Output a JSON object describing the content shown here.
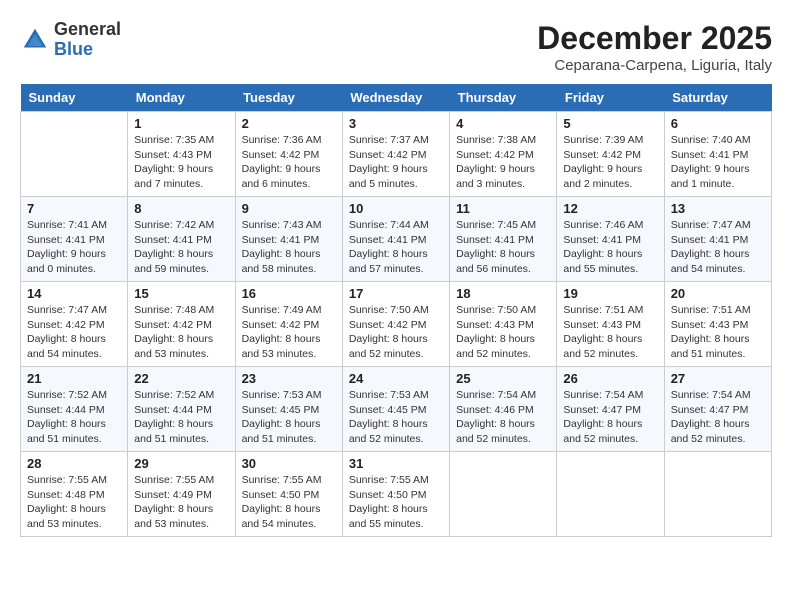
{
  "header": {
    "logo_general": "General",
    "logo_blue": "Blue",
    "month_title": "December 2025",
    "location": "Ceparana-Carpena, Liguria, Italy"
  },
  "weekdays": [
    "Sunday",
    "Monday",
    "Tuesday",
    "Wednesday",
    "Thursday",
    "Friday",
    "Saturday"
  ],
  "weeks": [
    [
      {
        "day": "",
        "info": ""
      },
      {
        "day": "1",
        "info": "Sunrise: 7:35 AM\nSunset: 4:43 PM\nDaylight: 9 hours\nand 7 minutes."
      },
      {
        "day": "2",
        "info": "Sunrise: 7:36 AM\nSunset: 4:42 PM\nDaylight: 9 hours\nand 6 minutes."
      },
      {
        "day": "3",
        "info": "Sunrise: 7:37 AM\nSunset: 4:42 PM\nDaylight: 9 hours\nand 5 minutes."
      },
      {
        "day": "4",
        "info": "Sunrise: 7:38 AM\nSunset: 4:42 PM\nDaylight: 9 hours\nand 3 minutes."
      },
      {
        "day": "5",
        "info": "Sunrise: 7:39 AM\nSunset: 4:42 PM\nDaylight: 9 hours\nand 2 minutes."
      },
      {
        "day": "6",
        "info": "Sunrise: 7:40 AM\nSunset: 4:41 PM\nDaylight: 9 hours\nand 1 minute."
      }
    ],
    [
      {
        "day": "7",
        "info": "Sunrise: 7:41 AM\nSunset: 4:41 PM\nDaylight: 9 hours\nand 0 minutes."
      },
      {
        "day": "8",
        "info": "Sunrise: 7:42 AM\nSunset: 4:41 PM\nDaylight: 8 hours\nand 59 minutes."
      },
      {
        "day": "9",
        "info": "Sunrise: 7:43 AM\nSunset: 4:41 PM\nDaylight: 8 hours\nand 58 minutes."
      },
      {
        "day": "10",
        "info": "Sunrise: 7:44 AM\nSunset: 4:41 PM\nDaylight: 8 hours\nand 57 minutes."
      },
      {
        "day": "11",
        "info": "Sunrise: 7:45 AM\nSunset: 4:41 PM\nDaylight: 8 hours\nand 56 minutes."
      },
      {
        "day": "12",
        "info": "Sunrise: 7:46 AM\nSunset: 4:41 PM\nDaylight: 8 hours\nand 55 minutes."
      },
      {
        "day": "13",
        "info": "Sunrise: 7:47 AM\nSunset: 4:41 PM\nDaylight: 8 hours\nand 54 minutes."
      }
    ],
    [
      {
        "day": "14",
        "info": "Sunrise: 7:47 AM\nSunset: 4:42 PM\nDaylight: 8 hours\nand 54 minutes."
      },
      {
        "day": "15",
        "info": "Sunrise: 7:48 AM\nSunset: 4:42 PM\nDaylight: 8 hours\nand 53 minutes."
      },
      {
        "day": "16",
        "info": "Sunrise: 7:49 AM\nSunset: 4:42 PM\nDaylight: 8 hours\nand 53 minutes."
      },
      {
        "day": "17",
        "info": "Sunrise: 7:50 AM\nSunset: 4:42 PM\nDaylight: 8 hours\nand 52 minutes."
      },
      {
        "day": "18",
        "info": "Sunrise: 7:50 AM\nSunset: 4:43 PM\nDaylight: 8 hours\nand 52 minutes."
      },
      {
        "day": "19",
        "info": "Sunrise: 7:51 AM\nSunset: 4:43 PM\nDaylight: 8 hours\nand 52 minutes."
      },
      {
        "day": "20",
        "info": "Sunrise: 7:51 AM\nSunset: 4:43 PM\nDaylight: 8 hours\nand 51 minutes."
      }
    ],
    [
      {
        "day": "21",
        "info": "Sunrise: 7:52 AM\nSunset: 4:44 PM\nDaylight: 8 hours\nand 51 minutes."
      },
      {
        "day": "22",
        "info": "Sunrise: 7:52 AM\nSunset: 4:44 PM\nDaylight: 8 hours\nand 51 minutes."
      },
      {
        "day": "23",
        "info": "Sunrise: 7:53 AM\nSunset: 4:45 PM\nDaylight: 8 hours\nand 51 minutes."
      },
      {
        "day": "24",
        "info": "Sunrise: 7:53 AM\nSunset: 4:45 PM\nDaylight: 8 hours\nand 52 minutes."
      },
      {
        "day": "25",
        "info": "Sunrise: 7:54 AM\nSunset: 4:46 PM\nDaylight: 8 hours\nand 52 minutes."
      },
      {
        "day": "26",
        "info": "Sunrise: 7:54 AM\nSunset: 4:47 PM\nDaylight: 8 hours\nand 52 minutes."
      },
      {
        "day": "27",
        "info": "Sunrise: 7:54 AM\nSunset: 4:47 PM\nDaylight: 8 hours\nand 52 minutes."
      }
    ],
    [
      {
        "day": "28",
        "info": "Sunrise: 7:55 AM\nSunset: 4:48 PM\nDaylight: 8 hours\nand 53 minutes."
      },
      {
        "day": "29",
        "info": "Sunrise: 7:55 AM\nSunset: 4:49 PM\nDaylight: 8 hours\nand 53 minutes."
      },
      {
        "day": "30",
        "info": "Sunrise: 7:55 AM\nSunset: 4:50 PM\nDaylight: 8 hours\nand 54 minutes."
      },
      {
        "day": "31",
        "info": "Sunrise: 7:55 AM\nSunset: 4:50 PM\nDaylight: 8 hours\nand 55 minutes."
      },
      {
        "day": "",
        "info": ""
      },
      {
        "day": "",
        "info": ""
      },
      {
        "day": "",
        "info": ""
      }
    ]
  ]
}
